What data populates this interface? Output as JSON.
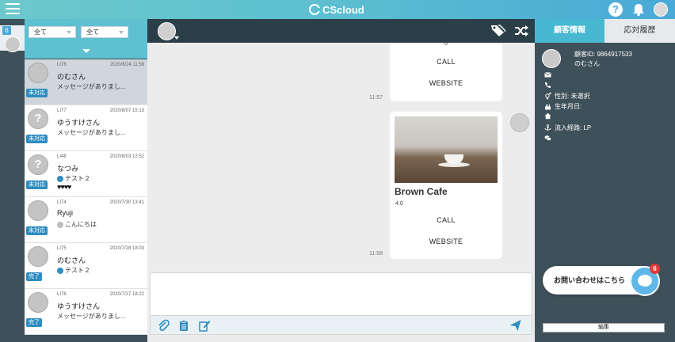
{
  "header": {
    "logo_text": "CScloud",
    "help_label": "?",
    "colors": {
      "accent": "#5ec0d0",
      "dark": "#3e5059"
    }
  },
  "leftstrip": {
    "badge_count": "6"
  },
  "filters": {
    "filter1": "全て",
    "filter2": "全て"
  },
  "conversations": [
    {
      "id": "LI78",
      "date": "2020/8/24 11:58",
      "name": "のむさん",
      "preview": "メッセージがありまし...",
      "status": "未対応",
      "avatar": ""
    },
    {
      "id": "LI77",
      "date": "2020/8/07 15:13",
      "name": "ゆうすけさん",
      "preview": "メッセージがありまし...",
      "status": "未対応",
      "avatar": "?"
    },
    {
      "id": "LI48",
      "date": "2020/8/03 12:52",
      "name": "なつみ",
      "preview": "テスト２",
      "status": "未対応",
      "avatar": "?",
      "hearts": "♥♥♥♥"
    },
    {
      "id": "LI74",
      "date": "2020/7/30 13:41",
      "name": "Ryuji",
      "preview": "こんにちは",
      "status": "未対応",
      "avatar": ""
    },
    {
      "id": "LI75",
      "date": "2020/7/28 18:03",
      "name": "のむさん",
      "preview": "テスト２",
      "status": "完了",
      "avatar": ""
    },
    {
      "id": "LI76",
      "date": "2020/7/27 18:22",
      "name": "ゆうすけさん",
      "preview": "メッセージがありまし...",
      "status": "完了",
      "avatar": ""
    }
  ],
  "chat": {
    "card1": {
      "rating": "0",
      "call": "CALL",
      "website": "WEBSITE",
      "time": "11:57"
    },
    "card2": {
      "title": "Brown Cafe",
      "rating": "4.0",
      "call": "CALL",
      "website": "WEBSITE",
      "time": "11:58"
    }
  },
  "rightpanel": {
    "tab_customer": "顧客情報",
    "tab_history": "応対履歴",
    "customer_id": "顧客ID: 9864917533",
    "customer_name": "のむさん",
    "gender": "性別: 未選択",
    "birthday": "生年月日:",
    "source": "流入経路: LP",
    "contact_button": "お問い合わせはこちら",
    "contact_badge": "6",
    "edit_button": "編集"
  }
}
